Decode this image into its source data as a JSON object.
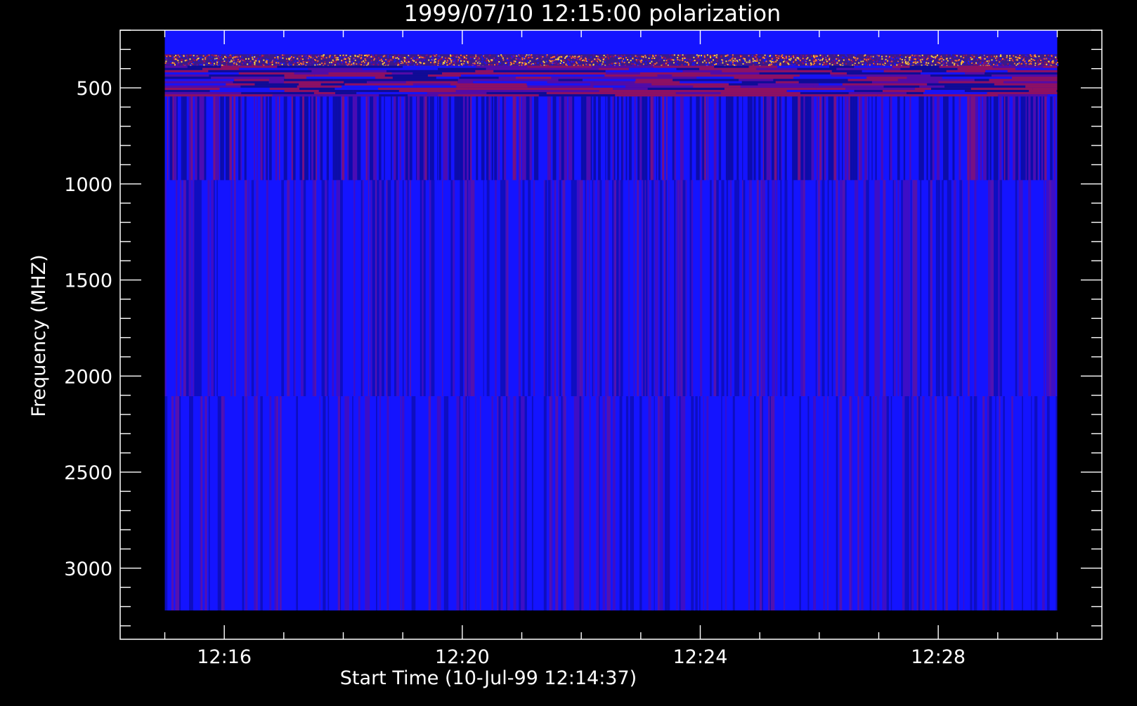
{
  "chart_data": {
    "type": "heatmap",
    "title": "1999/07/10 12:15:00 polarization",
    "xlabel": "Start Time (10-Jul-99 12:14:37)",
    "ylabel": "Frequency (MHZ)",
    "x_ticks": [
      "12:16",
      "12:20",
      "12:24",
      "12:28"
    ],
    "x_tick_values_min": [
      16,
      20,
      24,
      28
    ],
    "x_range_min": [
      14.25,
      30.75
    ],
    "data_x_range_min": [
      15.0,
      30.0
    ],
    "y_ticks": [
      500,
      1000,
      1500,
      2000,
      2500,
      3000
    ],
    "y_range": [
      200,
      3370
    ],
    "y_inverted": true,
    "grid": false,
    "colors": {
      "background": "#000000",
      "axis": "#ffffff",
      "base": "#1414ff",
      "stripe_dark": "#0a0a8c",
      "stripe_purple": "#5a0aa0",
      "stripe_red": "#a01050",
      "speckle_yellow": "#ffd23c",
      "speckle_orange": "#ff6e28"
    },
    "bands": [
      {
        "name": "uniform",
        "f_low": 200,
        "f_high": 325
      },
      {
        "name": "noisy-speckle",
        "f_low": 325,
        "f_high": 385
      },
      {
        "name": "dashed-lines",
        "f_low": 385,
        "f_high": 545
      },
      {
        "name": "streaked-dark",
        "f_low": 545,
        "f_high": 980
      },
      {
        "name": "streaked-medium",
        "f_low": 980,
        "f_high": 2105
      },
      {
        "name": "streaked-medium-2",
        "f_low": 2105,
        "f_high": 3220
      }
    ]
  }
}
